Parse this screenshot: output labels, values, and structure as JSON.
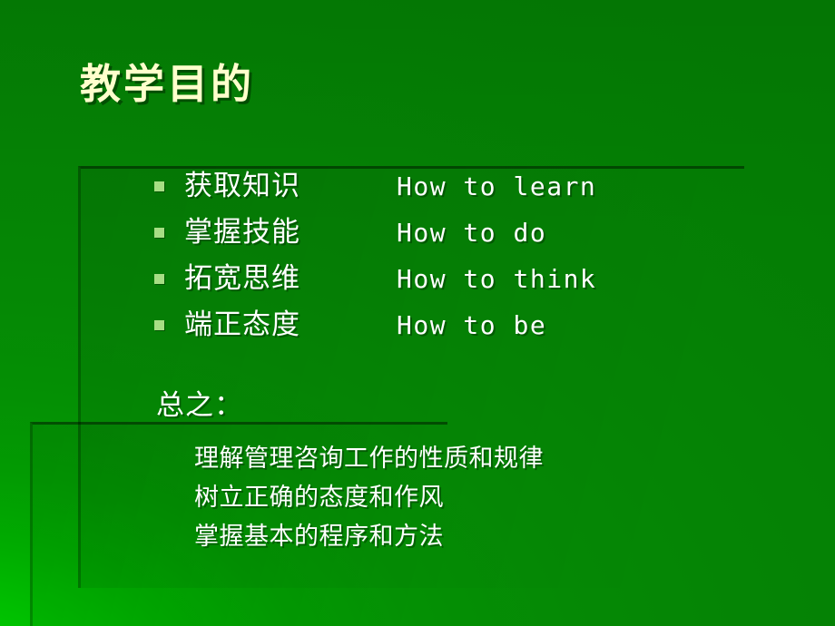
{
  "slide": {
    "title": "教学目的",
    "background_color_bright": "#00d200",
    "background_color_dark": "#047b04",
    "title_color": "#ffffcc",
    "body_color": "#ffffff",
    "bullet_marker_color": "#a7de84"
  },
  "bullets": [
    {
      "marker": "square-bullet",
      "cn": "获取知识",
      "en": "How to learn"
    },
    {
      "marker": "square-bullet",
      "cn": "掌握技能",
      "en": "How to do"
    },
    {
      "marker": "square-bullet",
      "cn": "拓宽思维",
      "en": "How to think"
    },
    {
      "marker": "square-bullet",
      "cn": "端正态度",
      "en": "How to be"
    }
  ],
  "summary": {
    "heading": "总之：",
    "lines": [
      "理解管理咨询工作的性质和规律",
      "树立正确的态度和作风",
      "掌握基本的程序和方法"
    ]
  }
}
